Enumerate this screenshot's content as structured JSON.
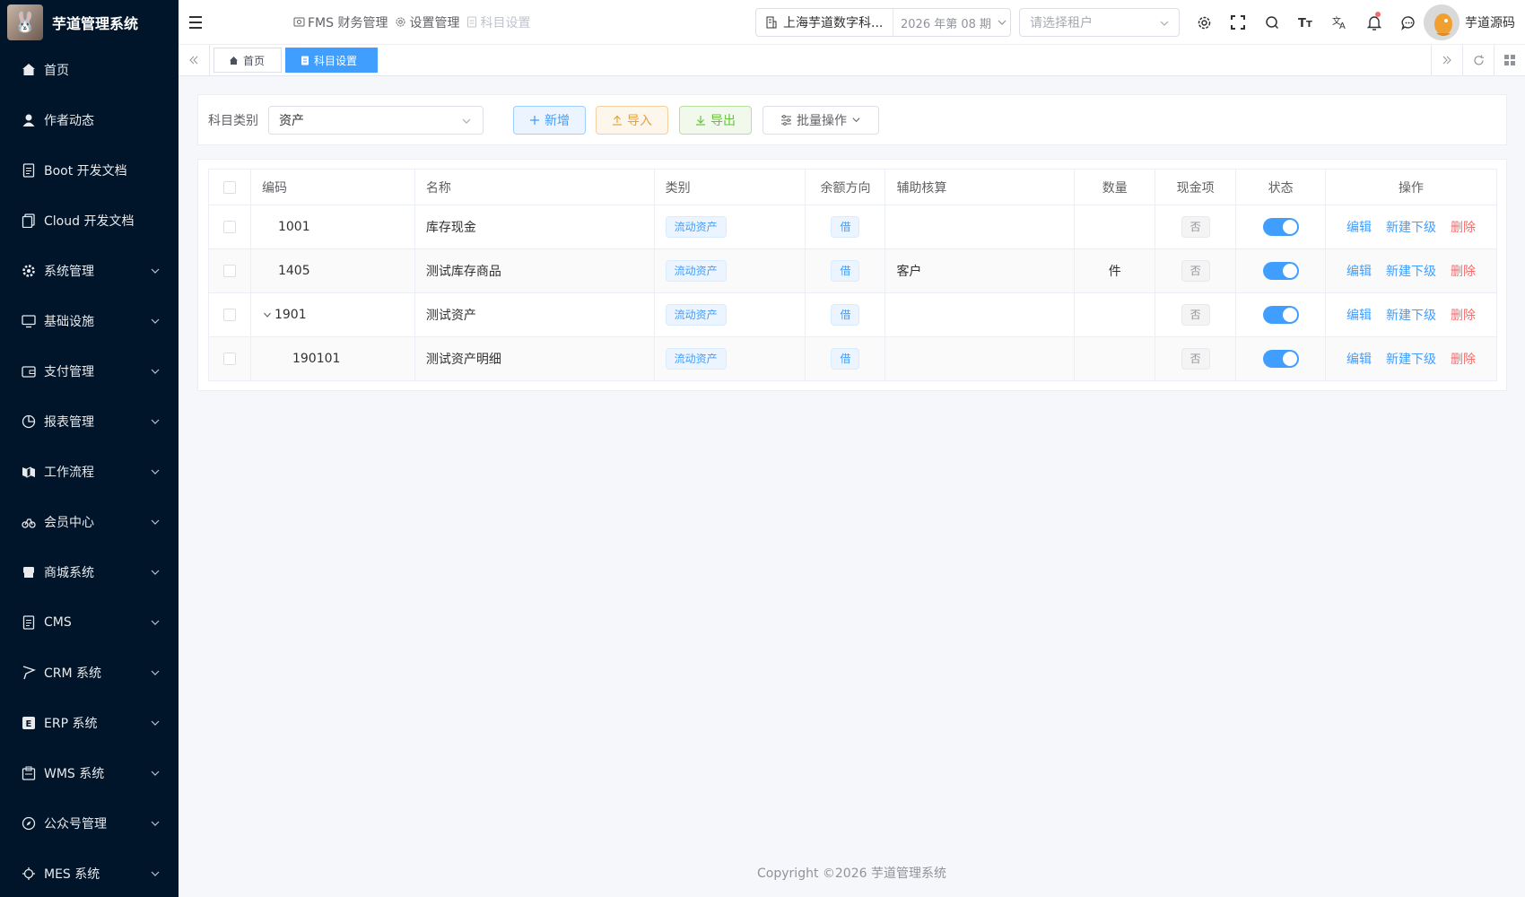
{
  "app": {
    "title": "芋道管理系统",
    "logo_icon": "rabbit-logo"
  },
  "sidebar": {
    "items": [
      {
        "label": "首页",
        "icon": "home-icon",
        "has_children": false
      },
      {
        "label": "作者动态",
        "icon": "user-icon",
        "has_children": false
      },
      {
        "label": "Boot 开发文档",
        "icon": "document-icon",
        "has_children": false
      },
      {
        "label": "Cloud 开发文档",
        "icon": "documents-icon",
        "has_children": false
      },
      {
        "label": "系统管理",
        "icon": "gear-icon",
        "has_children": true
      },
      {
        "label": "基础设施",
        "icon": "monitor-icon",
        "has_children": true
      },
      {
        "label": "支付管理",
        "icon": "wallet-icon",
        "has_children": true
      },
      {
        "label": "报表管理",
        "icon": "pie-chart-icon",
        "has_children": true
      },
      {
        "label": "工作流程",
        "icon": "workflow-icon",
        "has_children": true
      },
      {
        "label": "会员中心",
        "icon": "bicycle-icon",
        "has_children": true
      },
      {
        "label": "商城系统",
        "icon": "shop-icon",
        "has_children": true
      },
      {
        "label": "CMS",
        "icon": "document-icon",
        "has_children": true
      },
      {
        "label": "CRM 系统",
        "icon": "flag-icon",
        "has_children": true
      },
      {
        "label": "ERP 系统",
        "icon": "erp-icon",
        "has_children": true
      },
      {
        "label": "WMS 系统",
        "icon": "warehouse-icon",
        "has_children": true
      },
      {
        "label": "公众号管理",
        "icon": "compass-icon",
        "has_children": true
      },
      {
        "label": "MES 系统",
        "icon": "chip-icon",
        "has_children": true
      }
    ]
  },
  "header": {
    "breadcrumb": [
      {
        "label": "FMS 财务管理",
        "icon": "money-icon"
      },
      {
        "label": "设置管理",
        "icon": "gear-icon"
      },
      {
        "label": "科目设置",
        "icon": "file-icon"
      }
    ],
    "company": "上海芋道数字科...",
    "period": "2026 年第 08 期",
    "tenant_placeholder": "请选择租户",
    "user_name": "芋道源码"
  },
  "tags": {
    "items": [
      {
        "label": "首页",
        "icon": "home-icon",
        "active": false
      },
      {
        "label": "科目设置",
        "icon": "file-icon",
        "active": true
      }
    ]
  },
  "search": {
    "category_label": "科目类别",
    "category_value": "资产",
    "add_label": "新增",
    "import_label": "导入",
    "export_label": "导出",
    "batch_label": "批量操作"
  },
  "table": {
    "headers": {
      "code": "编码",
      "name": "名称",
      "category": "类别",
      "direction": "余额方向",
      "aux": "辅助核算",
      "qty": "数量",
      "cash": "现金项",
      "status": "状态",
      "actions": "操作"
    },
    "rows": [
      {
        "code": "1001",
        "name": "库存现金",
        "category": "流动资产",
        "direction": "借",
        "aux": "",
        "qty": "",
        "cash": "否",
        "status_on": true,
        "level": 0,
        "expandable": false
      },
      {
        "code": "1405",
        "name": "测试库存商品",
        "category": "流动资产",
        "direction": "借",
        "aux": "客户",
        "qty": "件",
        "cash": "否",
        "status_on": true,
        "level": 0,
        "expandable": false
      },
      {
        "code": "1901",
        "name": "测试资产",
        "category": "流动资产",
        "direction": "借",
        "aux": "",
        "qty": "",
        "cash": "否",
        "status_on": true,
        "level": 0,
        "expandable": true
      },
      {
        "code": "190101",
        "name": "测试资产明细",
        "category": "流动资产",
        "direction": "借",
        "aux": "",
        "qty": "",
        "cash": "否",
        "status_on": true,
        "level": 1,
        "expandable": false
      }
    ],
    "action_labels": {
      "edit": "编辑",
      "add_child": "新建下级",
      "delete": "删除"
    }
  },
  "footer": {
    "copyright": "Copyright ©2026 芋道管理系统"
  },
  "colors": {
    "sidebar_bg": "#001529",
    "primary": "#409eff",
    "danger": "#f56c6c",
    "warning": "#e6a23c",
    "success": "#67c23a"
  }
}
